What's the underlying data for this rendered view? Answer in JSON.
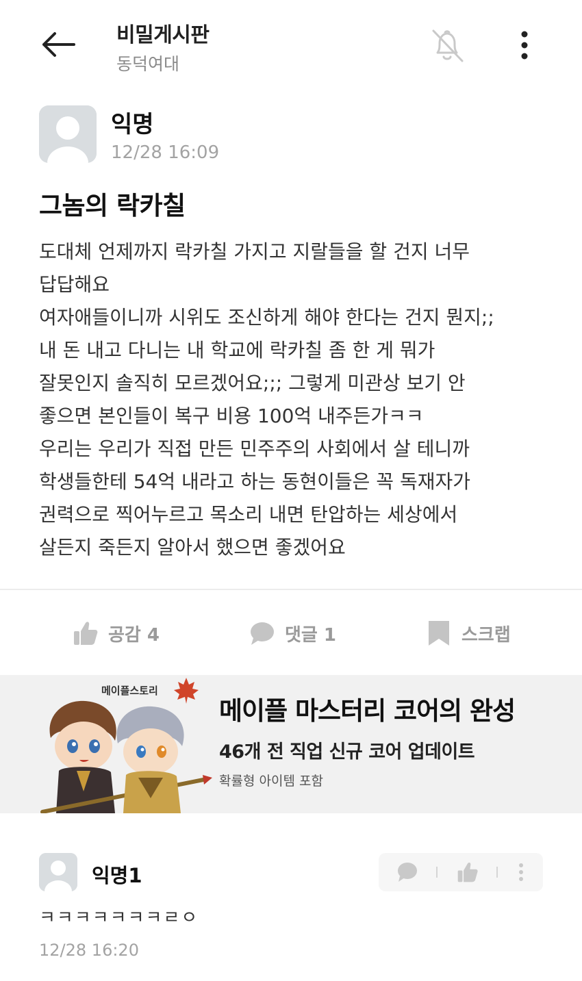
{
  "header": {
    "title": "비밀게시판",
    "subtitle": "동덕여대",
    "back_icon": "arrow-left-icon",
    "bell_icon": "bell-off-icon",
    "more_icon": "more-vertical-icon"
  },
  "post": {
    "author": "익명",
    "time": "12/28 16:09",
    "title": "그놈의 락카칠",
    "body_lines": [
      "도대체 언제까지 락카칠 가지고 지랄들을 할 건지 너무",
      "답답해요",
      "여자애들이니까 시위도 조신하게 해야 한다는 건지 뭔지;;",
      "내 돈 내고 다니는 내 학교에 락카칠 좀 한 게 뭐가",
      "잘못인지 솔직히 모르겠어요;;; 그렇게 미관상 보기 안",
      "좋으면 본인들이 복구 비용 100억 내주든가ㅋㅋ",
      "우리는 우리가 직접 만든 민주주의 사회에서 살 테니까",
      "학생들한테 54억 내라고 하는 동현이들은 꼭 독재자가",
      "권력으로 찍어누르고 목소리 내면 탄압하는 세상에서",
      "살든지 죽든지 알아서 했으면 좋겠어요"
    ]
  },
  "actions": {
    "like_label": "공감 4",
    "comment_label": "댓글 1",
    "scrap_label": "스크랩"
  },
  "ad": {
    "brand": "메이플스토리",
    "headline": "메이플 마스터리 코어의 완성",
    "subline": "46개 전 직업 신규 코어 업데이트",
    "note": "확률형 아이템 포함"
  },
  "comment": {
    "author": "익명1",
    "text": "ㅋㅋㅋㅋㅋㅋㅋㄹㅇ",
    "time": "12/28 16:20"
  },
  "colors": {
    "accent_gray": "#9a9a9a",
    "avatar_bg": "#d9dde0",
    "ad_bg": "#f1f1f1"
  }
}
